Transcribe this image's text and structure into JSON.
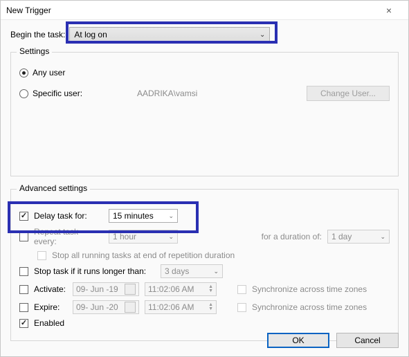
{
  "window": {
    "title": "New Trigger"
  },
  "begin": {
    "label": "Begin the task:",
    "selected": "At log on"
  },
  "settings": {
    "legend": "Settings",
    "any_user_label": "Any user",
    "specific_user_label": "Specific user:",
    "specific_user_value": "AADRIKA\\vamsi",
    "change_user_btn": "Change User..."
  },
  "advanced": {
    "legend": "Advanced settings",
    "delay": {
      "label": "Delay task for:",
      "checked": true,
      "value": "15 minutes"
    },
    "repeat": {
      "label": "Repeat task every:",
      "checked": false,
      "value": "1 hour",
      "duration_label": "for a duration of:",
      "duration_value": "1 day"
    },
    "stop_all_label": "Stop all running tasks at end of repetition duration",
    "stop_if": {
      "label": "Stop task if it runs longer than:",
      "value": "3 days"
    },
    "activate": {
      "label": "Activate:",
      "date": "09- Jun -19",
      "time": "11:02:06 AM",
      "sync_label": "Synchronize across time zones"
    },
    "expire": {
      "label": "Expire:",
      "date": "09- Jun -20",
      "time": "11:02:06 AM",
      "sync_label": "Synchronize across time zones"
    },
    "enabled_label": "Enabled"
  },
  "footer": {
    "ok": "OK",
    "cancel": "Cancel"
  }
}
